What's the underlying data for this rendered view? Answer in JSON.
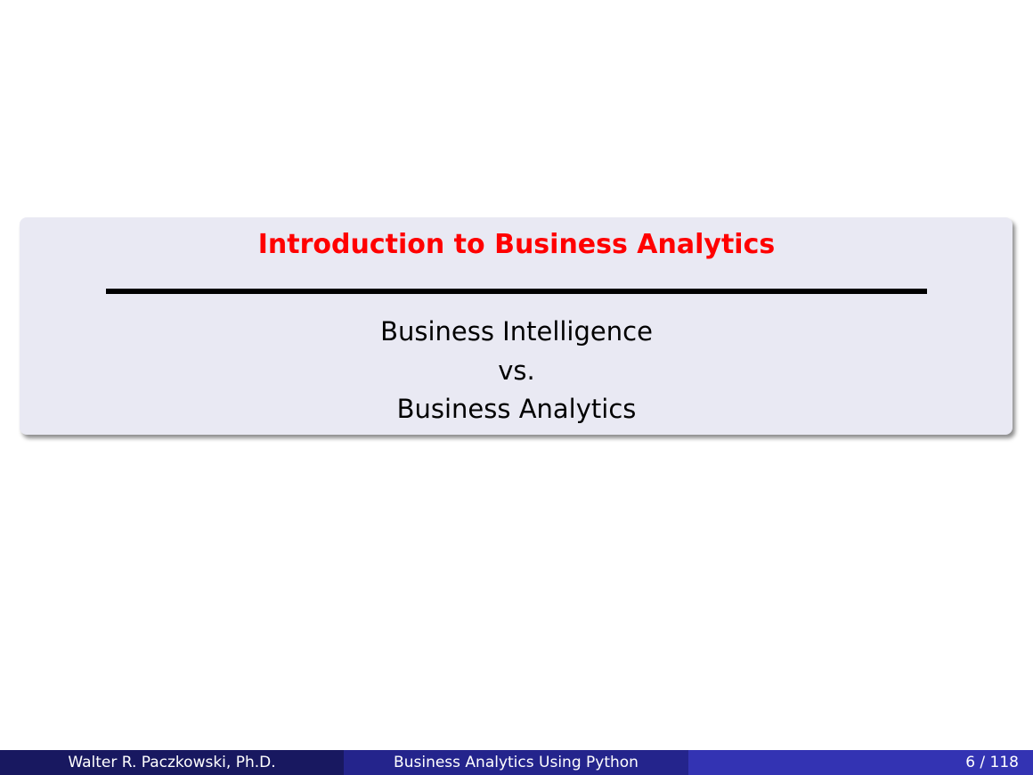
{
  "slide": {
    "block_title": "Introduction to Business Analytics",
    "subtitle_lines": [
      "Business Intelligence",
      "vs.",
      "Business Analytics"
    ],
    "colors": {
      "title": "#ff0000",
      "block_background": "#e9e9f3",
      "footer_author_bg": "#181860",
      "footer_title_bg": "#24248c",
      "footer_page_bg": "#3333b3"
    }
  },
  "footer": {
    "author": "Walter R. Paczkowski, Ph.D.",
    "title": "Business Analytics Using Python",
    "page": "6 / 118"
  }
}
